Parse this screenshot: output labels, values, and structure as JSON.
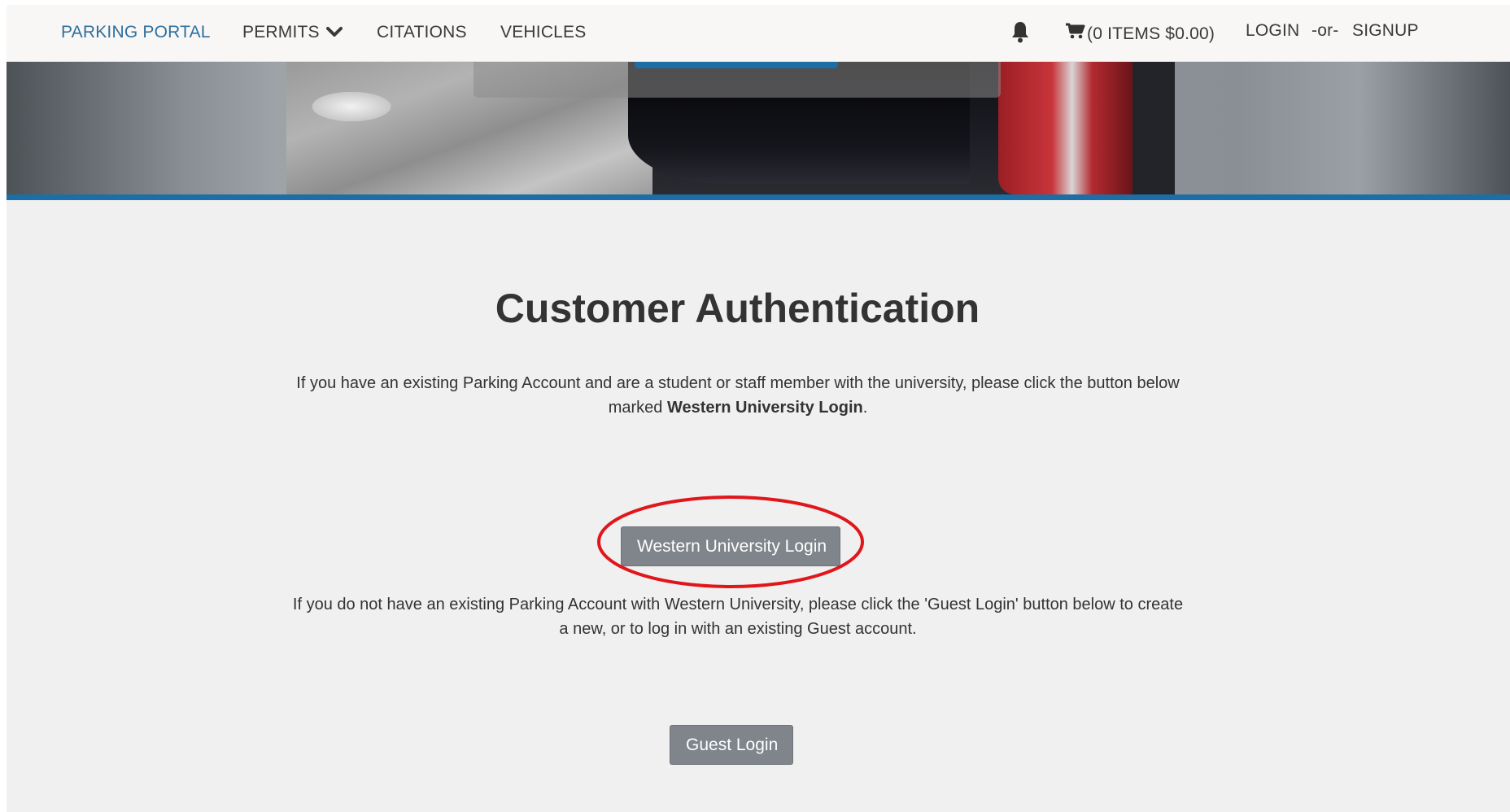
{
  "nav": {
    "brand": "PARKING PORTAL",
    "permits": "PERMITS",
    "citations": "CITATIONS",
    "vehicles": "VEHICLES",
    "cart": "(0 ITEMS $0.00)",
    "login": "LOGIN",
    "or": "-or-",
    "signup": "SIGNUP"
  },
  "icons": {
    "permits_dropdown": "chevron-down-icon",
    "notifications": "bell-icon",
    "cart": "cart-icon"
  },
  "main": {
    "title": "Customer Authentication",
    "para1_before": "If you have an existing Parking Account and are a student or staff member with the university, please click the button below marked ",
    "para1_bold": "Western University Login",
    "para1_after": ".",
    "western_button": "Western University Login",
    "para2": "If you do not have an existing Parking Account with Western University, please click the 'Guest Login' button below to create a new, or to log in with an existing Guest account.",
    "guest_button": "Guest Login"
  },
  "colors": {
    "brand_blue": "#2f6f9f",
    "accent_bar": "#1c6ea4",
    "button_gray": "#7f858b",
    "annotation_red": "#e0161b"
  }
}
